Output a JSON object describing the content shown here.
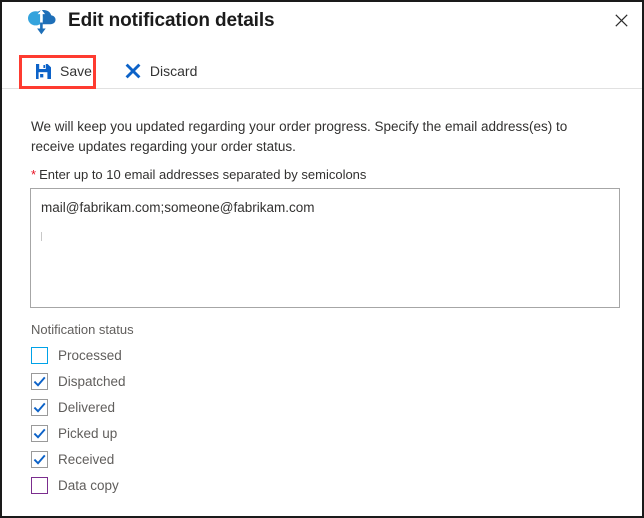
{
  "window": {
    "title": "Edit notification details",
    "icon": "cloud-upload-download-icon",
    "close_label": "×"
  },
  "toolbar": {
    "save_label": "Save",
    "save_icon": "save-floppy-icon",
    "discard_label": "Discard",
    "discard_icon": "close-x-icon",
    "highlight_color": "#fe3b30"
  },
  "main": {
    "intro_text": "We will keep you updated regarding your order progress. Specify the email address(es) to receive updates regarding your order status.",
    "field": {
      "required_marker": "*",
      "label": "Enter up to 10 email addresses separated by semicolons",
      "value": "mail@fabrikam.com;someone@fabrikam.com",
      "placeholder": ""
    },
    "status_section": {
      "heading": "Notification status",
      "items": [
        {
          "label": "Processed",
          "checked": false,
          "style": "focus"
        },
        {
          "label": "Dispatched",
          "checked": true,
          "style": "normal"
        },
        {
          "label": "Delivered",
          "checked": true,
          "style": "normal"
        },
        {
          "label": "Picked up",
          "checked": true,
          "style": "normal"
        },
        {
          "label": "Received",
          "checked": true,
          "style": "normal"
        },
        {
          "label": "Data copy",
          "checked": false,
          "style": "accent-purple"
        }
      ]
    }
  },
  "colors": {
    "accent_blue": "#0078d4",
    "check_blue": "#0c62c8",
    "focus_cyan": "#00a2e8",
    "purple": "#7b2d8e",
    "required_red": "#e81123",
    "text": "#323130",
    "muted_text": "#605e5c"
  }
}
